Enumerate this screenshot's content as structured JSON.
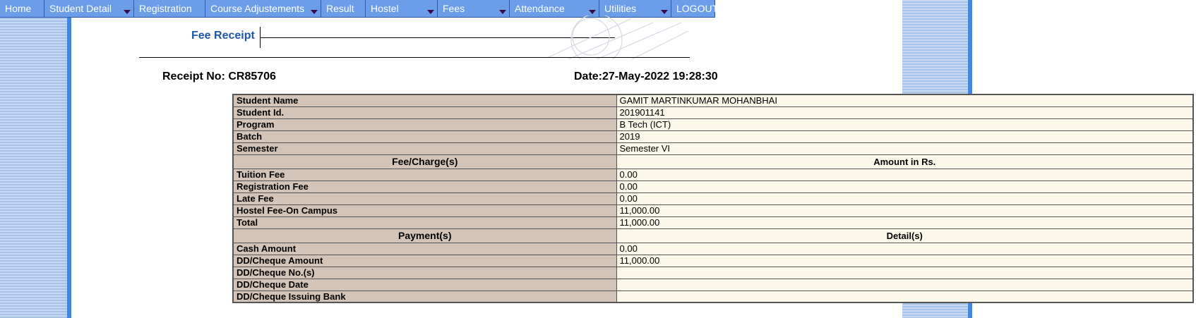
{
  "nav": {
    "items": [
      {
        "label": "Home",
        "dropdown": false,
        "width": 63
      },
      {
        "label": "Student Detail",
        "dropdown": true,
        "width": 127
      },
      {
        "label": "Registration",
        "dropdown": false,
        "width": 101
      },
      {
        "label": "Course Adjustements",
        "dropdown": true,
        "width": 164
      },
      {
        "label": "Result",
        "dropdown": false,
        "width": 63
      },
      {
        "label": "Hostel",
        "dropdown": true,
        "width": 102
      },
      {
        "label": "Fees",
        "dropdown": true,
        "width": 102
      },
      {
        "label": "Attendance",
        "dropdown": true,
        "width": 127
      },
      {
        "label": "Utilities",
        "dropdown": true,
        "width": 102
      },
      {
        "label": "LOGOUT",
        "dropdown": false,
        "width": 62
      }
    ]
  },
  "header": {
    "title": "Fee Receipt",
    "receipt_no": "Receipt No: CR85706",
    "date": "Date:27-May-2022 19:28:30"
  },
  "student": [
    {
      "label": "Student Name",
      "value": "GAMIT MARTINKUMAR MOHANBHAI"
    },
    {
      "label": "Student Id.",
      "value": "201901141"
    },
    {
      "label": "Program",
      "value": "B Tech (ICT)"
    },
    {
      "label": "Batch",
      "value": "2019"
    },
    {
      "label": "Semester",
      "value": "Semester VI"
    }
  ],
  "fees_header": {
    "label": "Fee/Charge(s)",
    "value": "Amount in Rs."
  },
  "fees": [
    {
      "label": "Tuition Fee",
      "value": "0.00"
    },
    {
      "label": "Registration Fee",
      "value": "0.00"
    },
    {
      "label": "Late Fee",
      "value": "0.00"
    },
    {
      "label": "Hostel Fee-On Campus",
      "value": "11,000.00"
    },
    {
      "label": "Total",
      "value": "11,000.00"
    }
  ],
  "payment_header": {
    "label": "Payment(s)",
    "value": "Detail(s)"
  },
  "payments": [
    {
      "label": "Cash Amount",
      "value": "0.00"
    },
    {
      "label": "DD/Cheque Amount",
      "value": "11,000.00"
    },
    {
      "label": "DD/Cheque No.(s)",
      "value": ""
    },
    {
      "label": "DD/Cheque Date",
      "value": ""
    },
    {
      "label": "DD/Cheque Issuing Bank",
      "value": ""
    }
  ],
  "colors": {
    "nav_bg": "#6b9de8",
    "label_bg": "#d4c3b7",
    "value_bg": "#fbf8ea",
    "title": "#1f57a8",
    "accent_bar": "#3f86e6"
  }
}
